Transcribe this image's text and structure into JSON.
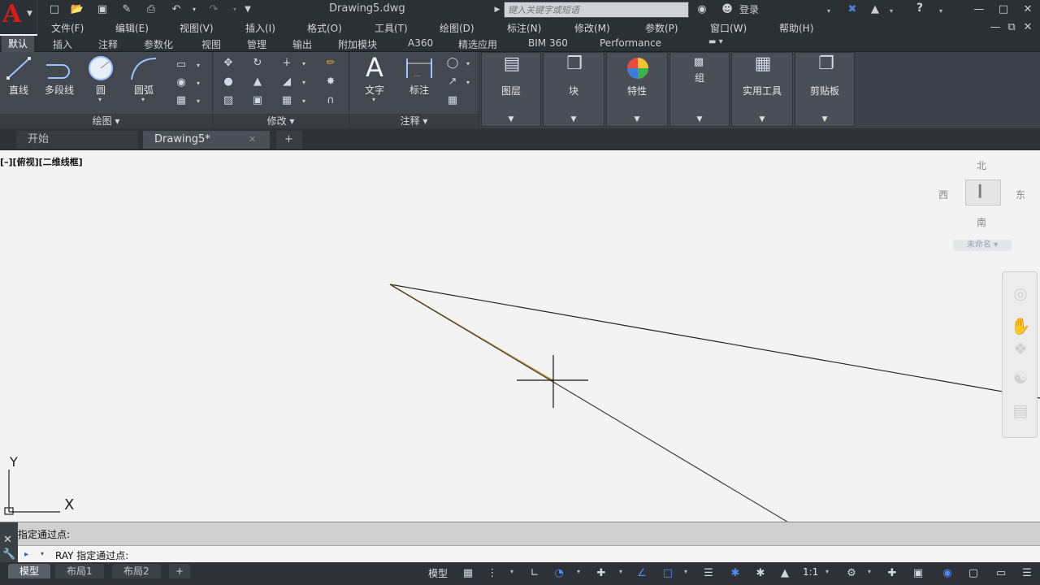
{
  "app": {
    "logo_letter": "A",
    "document_title": "Drawing5.dwg"
  },
  "titlebar": {
    "search_placeholder": "键入关键字或短语",
    "login_label": "登录",
    "help_label": "?"
  },
  "menus": [
    "文件(F)",
    "编辑(E)",
    "视图(V)",
    "插入(I)",
    "格式(O)",
    "工具(T)",
    "绘图(D)",
    "标注(N)",
    "修改(M)",
    "参数(P)",
    "窗口(W)",
    "帮助(H)"
  ],
  "ribbon_tabs": [
    "默认",
    "插入",
    "注释",
    "参数化",
    "视图",
    "管理",
    "输出",
    "附加模块",
    "A360",
    "精选应用",
    "BIM 360",
    "Performance"
  ],
  "ribbon": {
    "draw": {
      "title": "绘图",
      "line": "直线",
      "polyline": "多段线",
      "circle": "圆",
      "arc": "圆弧"
    },
    "modify": {
      "title": "修改"
    },
    "annotation": {
      "title": "注释",
      "text": "文字",
      "dimension": "标注"
    },
    "layers": "图层",
    "block": "块",
    "properties": "特性",
    "group": "组",
    "utilities": "实用工具",
    "clipboard": "剪贴板"
  },
  "doc_tabs": {
    "start": "开始",
    "drawing": "Drawing5*",
    "new": "+"
  },
  "viewport": {
    "label": "[–][俯视][二维线框]",
    "compass": {
      "north": "北",
      "south": "南",
      "east": "东",
      "west": "西"
    },
    "ucs_name": "未命名",
    "axis_x": "X",
    "axis_y": "Y"
  },
  "command": {
    "history": "指定通过点:",
    "current_prompt": "RAY 指定通过点:"
  },
  "status": {
    "layouts": [
      "模型",
      "布局1",
      "布局2"
    ],
    "add_layout": "+",
    "model_label": "模型",
    "scale": "1:1"
  },
  "colors": {
    "accent_red": "#d81c1c",
    "ribbon_bg": "#3d4149",
    "canvas_bg": "#f3f3f3"
  }
}
